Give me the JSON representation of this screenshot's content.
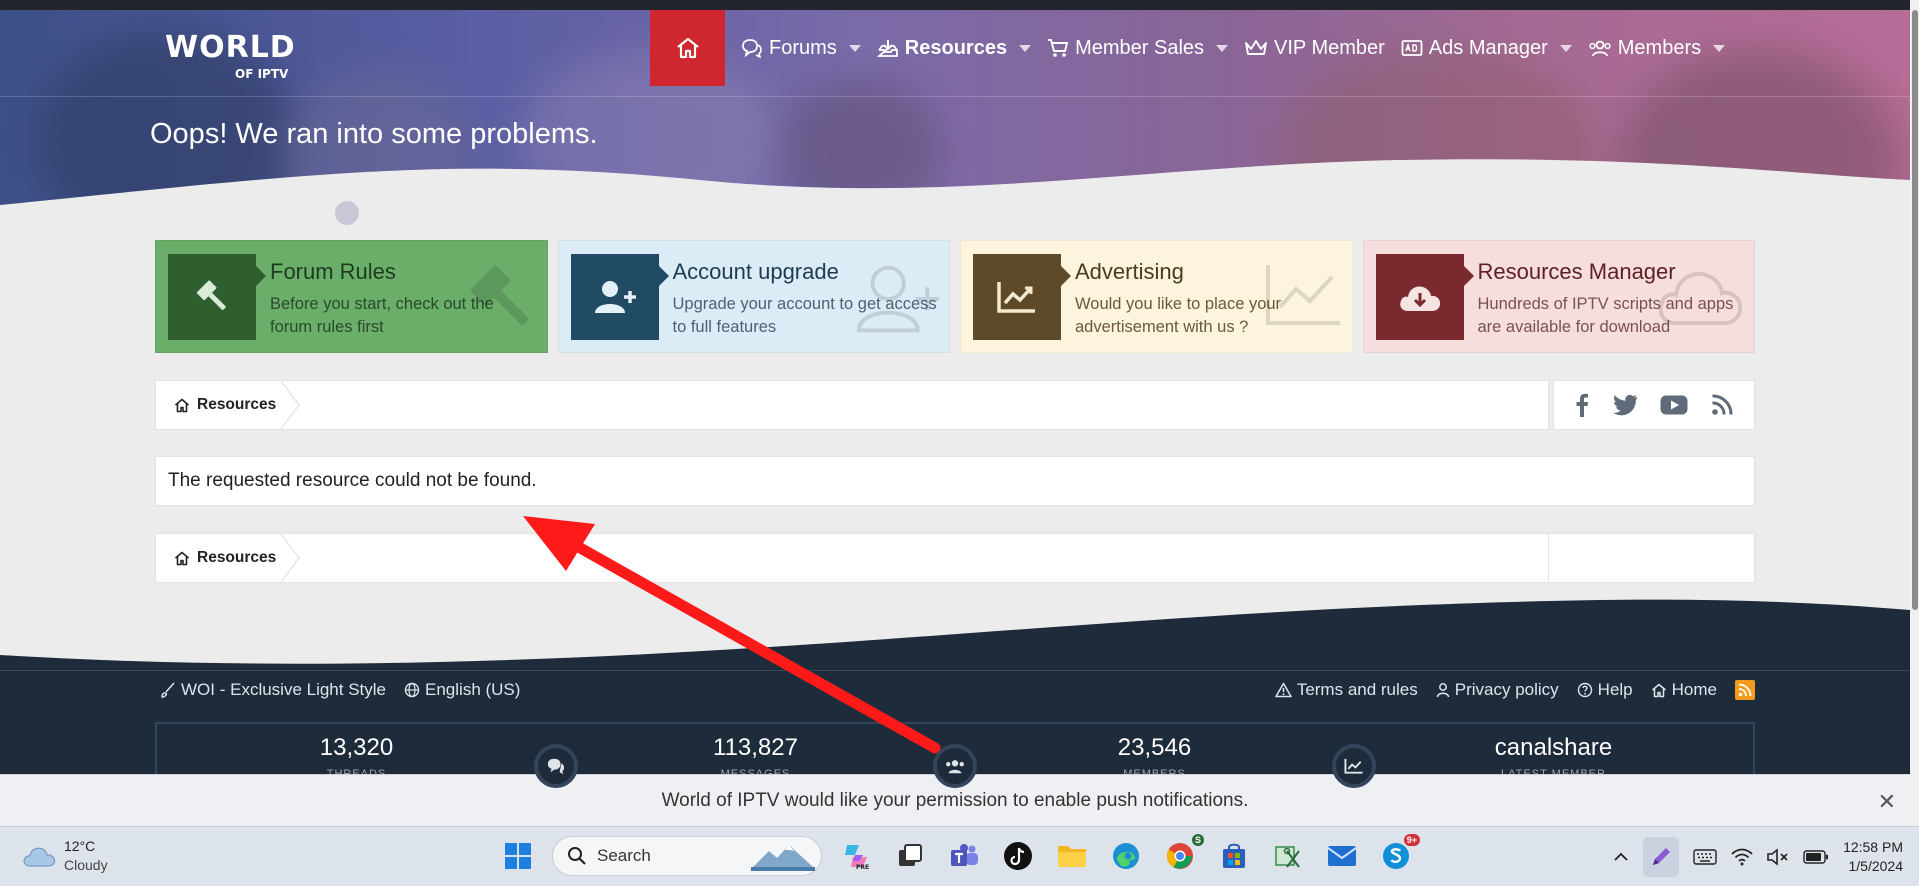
{
  "site": {
    "logo_big": "WORLD",
    "logo_small": "OF IPTV"
  },
  "nav": {
    "items": [
      {
        "label": "Forums",
        "icon": "comments-icon",
        "caret": true
      },
      {
        "label": "Resources",
        "icon": "download-tray-icon",
        "caret": true,
        "bold": true
      },
      {
        "label": "Member Sales",
        "icon": "cart-icon",
        "caret": true
      },
      {
        "label": "VIP Member",
        "icon": "crown-icon",
        "caret": false
      },
      {
        "label": "Ads Manager",
        "icon": "ad-card-icon",
        "caret": true
      },
      {
        "label": "Members",
        "icon": "users-icon",
        "caret": true
      }
    ]
  },
  "hero": {
    "title": "Oops! We ran into some problems."
  },
  "cards": [
    {
      "title": "Forum Rules",
      "text": "Before you start, check out the forum rules first",
      "bg": "#6aae6a",
      "iconbg": "#2f5e2f",
      "titleColor": "#1d3b1d",
      "textColor": "#2a4a2a",
      "icon": "gavel-icon"
    },
    {
      "title": "Account upgrade",
      "text": "Upgrade your account to get access to full features",
      "bg": "#dcecf6",
      "iconbg": "#214a63",
      "titleColor": "#1d3c52",
      "textColor": "#4a6272",
      "icon": "user-plus-icon"
    },
    {
      "title": "Advertising",
      "text": "Would you like to place your advertisement with us ?",
      "bg": "#fcf4dc",
      "iconbg": "#5e4a28",
      "titleColor": "#4a3a1e",
      "textColor": "#6a5a3a",
      "icon": "chart-line-icon"
    },
    {
      "title": "Resources Manager",
      "text": "Hundreds of IPTV scripts and apps are available for download",
      "bg": "#f6dede",
      "iconbg": "#7a2a2e",
      "titleColor": "#5e2024",
      "textColor": "#7a5050",
      "icon": "cloud-download-icon"
    }
  ],
  "breadcrumb": {
    "label": "Resources"
  },
  "social": [
    "facebook-icon",
    "twitter-icon",
    "youtube-icon",
    "rss-icon"
  ],
  "message": {
    "text": "The requested resource could not be found."
  },
  "footer": {
    "style_label": "WOI - Exclusive Light Style",
    "language_label": "English (US)",
    "links": [
      "Terms and rules",
      "Privacy policy",
      "Help",
      "Home"
    ]
  },
  "stats": [
    {
      "value": "13,320",
      "label": "THREADS",
      "icon": "comments-icon"
    },
    {
      "value": "113,827",
      "label": "MESSAGES",
      "icon": "users-icon"
    },
    {
      "value": "23,546",
      "label": "MEMBERS",
      "icon": "chart-line-icon"
    },
    {
      "value": "canalshare",
      "label": "LATEST MEMBER",
      "icon": ""
    }
  ],
  "push": {
    "text": "World of IPTV would like your permission to enable push notifications.",
    "close": "✕"
  },
  "taskbar": {
    "weather_temp": "12°C",
    "weather_desc": "Cloudy",
    "search_label": "Search",
    "chrome_badge": "S",
    "skype_badge": "9+",
    "time": "12:58 PM",
    "date": "1/5/2024"
  },
  "colors": {
    "accent_red": "#cf2630",
    "footer_bg": "#1e2b3a",
    "arrow_red": "#ff1a1a"
  }
}
